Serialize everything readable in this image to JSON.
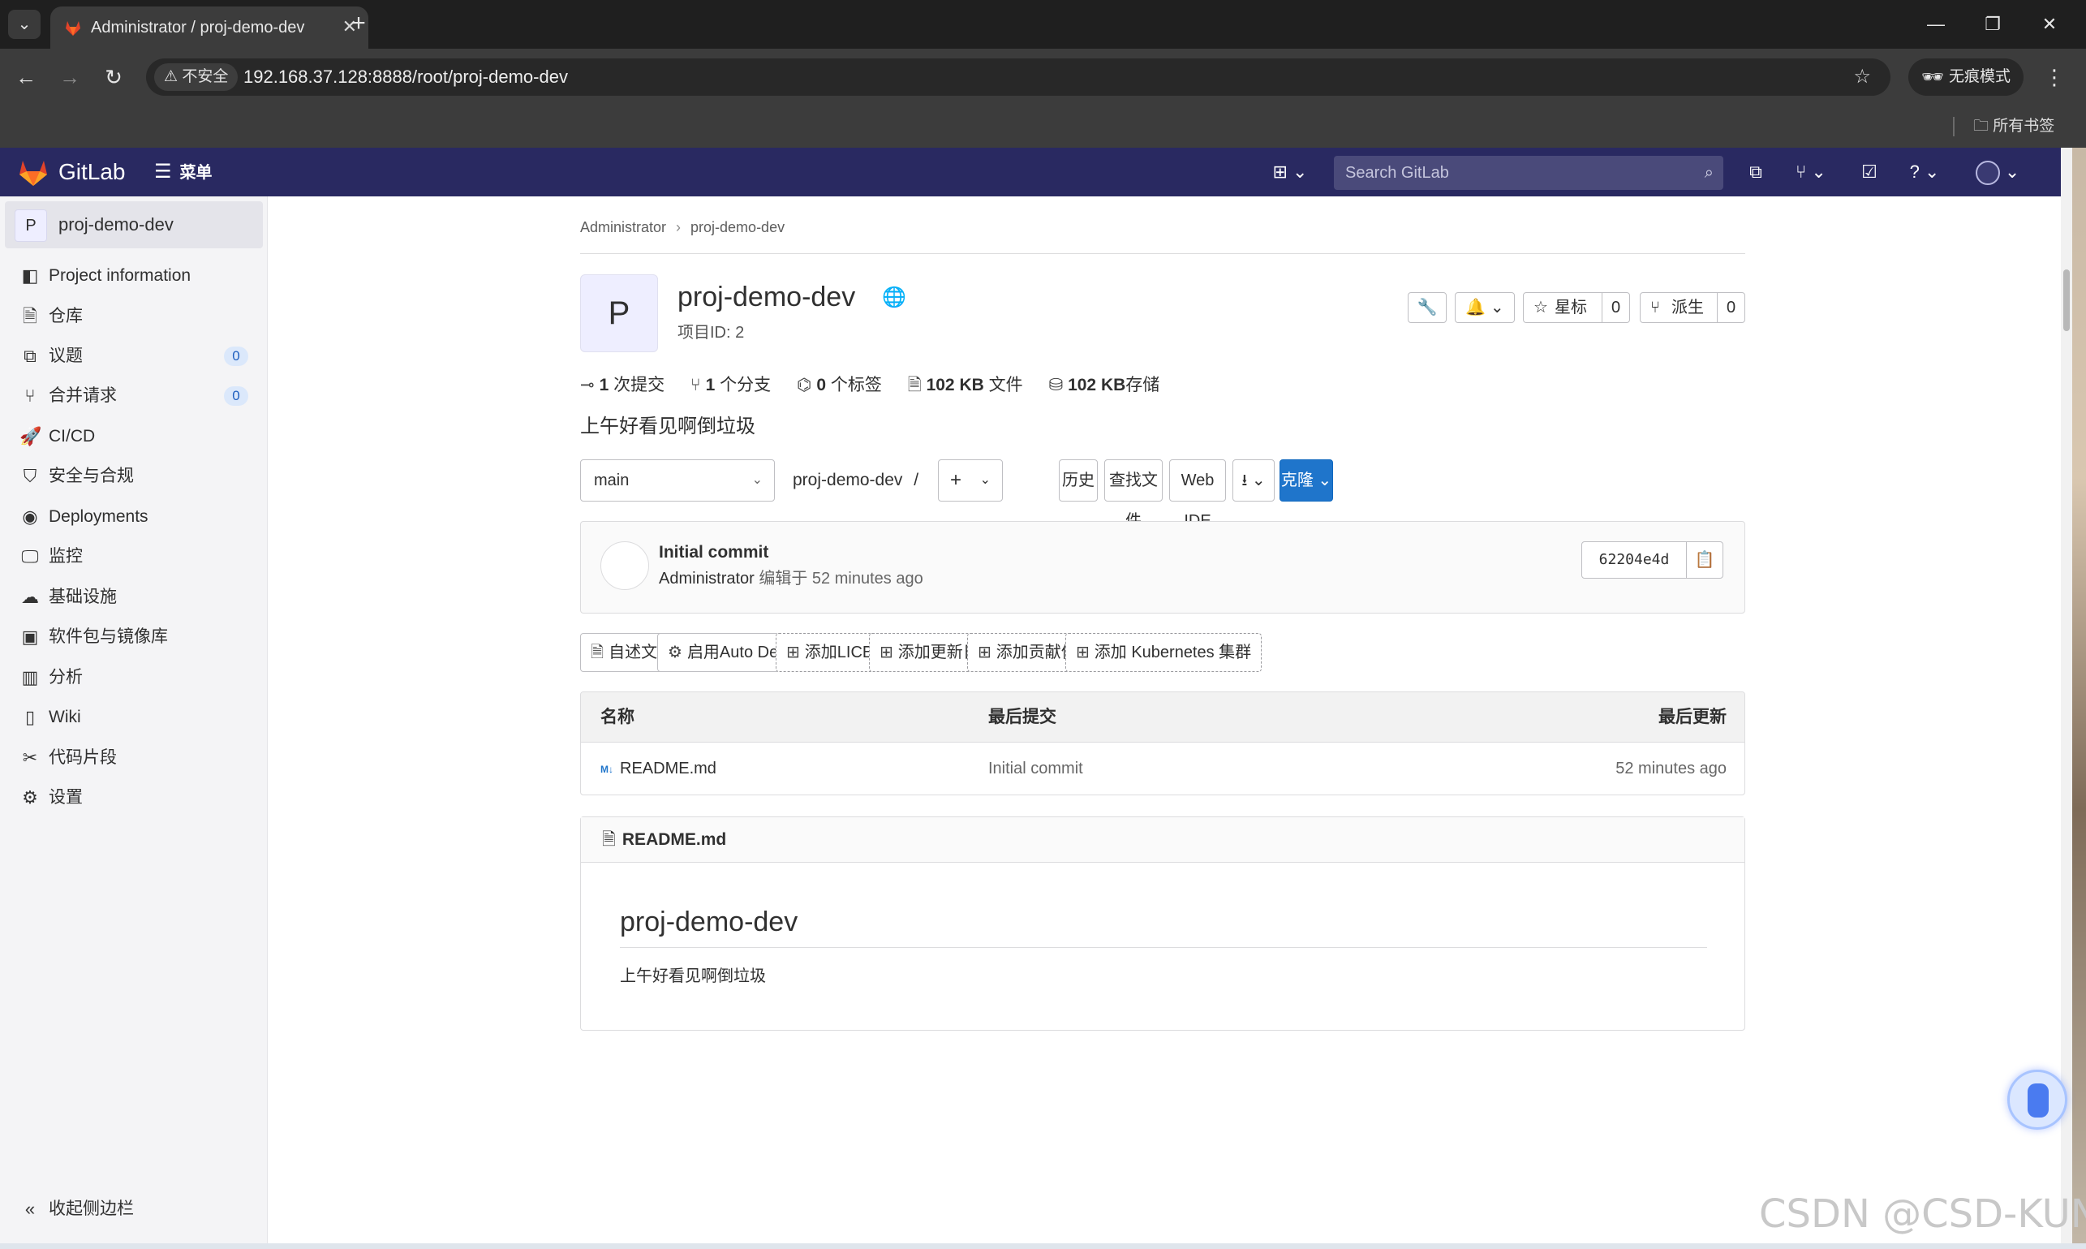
{
  "browser": {
    "tab_title": "Administrator / proj-demo-dev",
    "tab_close": "✕",
    "new_tab": "+",
    "security_label": "不安全",
    "url": "192.168.37.128:8888/root/proj-demo-dev",
    "incognito_label": "无痕模式",
    "bookmarks_all": "所有书签",
    "icons": {
      "back": "arrow-left-icon",
      "forward": "arrow-right-icon",
      "reload": "reload-icon",
      "star": "star-icon",
      "incognito": "incognito-icon",
      "menu": "kebab-icon",
      "folder": "folder-icon"
    }
  },
  "gitlab_nav": {
    "brand": "GitLab",
    "menu_label": "菜单",
    "search_placeholder": "Search GitLab",
    "colors": {
      "nav_bg": "#292961",
      "primary": "#1f75cb"
    }
  },
  "sidebar": {
    "project_initial": "P",
    "project_name": "proj-demo-dev",
    "items": [
      {
        "label": "Project information",
        "icon": "info-icon"
      },
      {
        "label": "仓库",
        "icon": "repository-icon"
      },
      {
        "label": "议题",
        "icon": "issues-icon",
        "badge": "0"
      },
      {
        "label": "合并请求",
        "icon": "merge-request-icon",
        "badge": "0"
      },
      {
        "label": "CI/CD",
        "icon": "rocket-icon"
      },
      {
        "label": "安全与合规",
        "icon": "shield-icon"
      },
      {
        "label": "Deployments",
        "icon": "deployments-icon"
      },
      {
        "label": "监控",
        "icon": "monitor-icon"
      },
      {
        "label": "基础设施",
        "icon": "cloud-icon"
      },
      {
        "label": "软件包与镜像库",
        "icon": "package-icon"
      },
      {
        "label": "分析",
        "icon": "chart-icon"
      },
      {
        "label": "Wiki",
        "icon": "book-icon"
      },
      {
        "label": "代码片段",
        "icon": "snippet-icon"
      },
      {
        "label": "设置",
        "icon": "gear-icon"
      }
    ],
    "collapse_label": "收起侧边栏"
  },
  "breadcrumb": {
    "items": [
      "Administrator",
      "proj-demo-dev"
    ]
  },
  "project": {
    "initial": "P",
    "name": "proj-demo-dev",
    "id_label": "项目ID: 2",
    "star_label": "星标",
    "star_count": "0",
    "fork_label": "派生",
    "fork_count": "0",
    "description": "上午好看见啊倒垃圾"
  },
  "stats": {
    "commits_num": "1",
    "commits_label": "次提交",
    "branches_num": "1",
    "branches_label": "个分支",
    "tags_num": "0",
    "tags_label": "个标签",
    "files_size": "102 KB",
    "files_label": "文件",
    "storage_size": "102 KB",
    "storage_label": "存储"
  },
  "repo_toolbar": {
    "branch": "main",
    "path": "proj-demo-dev",
    "path_sep": "/",
    "history": "历史",
    "find_file": "查找文件",
    "web_ide": "Web IDE",
    "clone": "克隆"
  },
  "last_commit": {
    "title": "Initial commit",
    "author": "Administrator",
    "meta": "编辑于 52 minutes ago",
    "sha": "62204e4d"
  },
  "quick_actions": [
    "自述文件",
    "启用Auto DevOps",
    "添加LICENSE",
    "添加更新日志",
    "添加贡献信息",
    "添加 Kubernetes 集群"
  ],
  "file_tree": {
    "headers": {
      "name": "名称",
      "last_commit": "最后提交",
      "last_update": "最后更新"
    },
    "rows": [
      {
        "name": "README.md",
        "commit": "Initial commit",
        "updated": "52 minutes ago"
      }
    ]
  },
  "readme": {
    "filename": "README.md",
    "heading": "proj-demo-dev",
    "body": "上午好看见啊倒垃圾"
  },
  "watermark": "CSDN @CSD-KUN"
}
